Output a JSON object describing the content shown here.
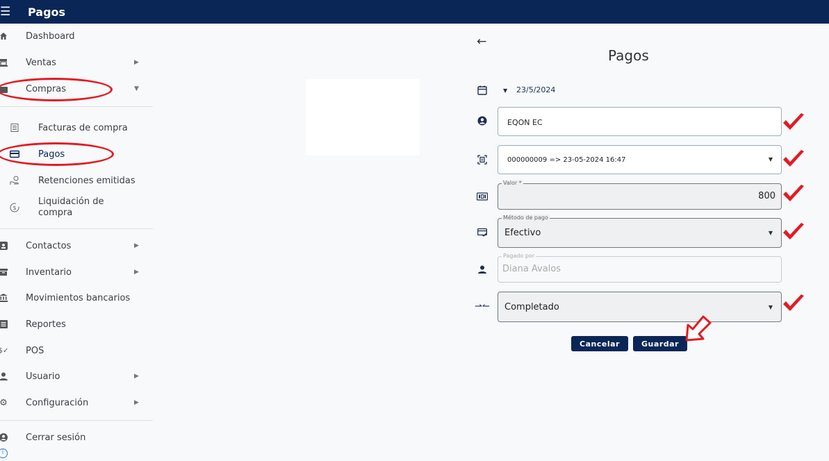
{
  "app": {
    "title": "Pagos",
    "menu_icon": "hamburger-icon"
  },
  "sidebar": {
    "items": [
      {
        "label": "Dashboard",
        "icon": "home-icon"
      },
      {
        "label": "Ventas",
        "icon": "register-icon",
        "expandable": true
      },
      {
        "label": "Compras",
        "icon": "bag-icon",
        "expanded": true
      },
      {
        "label": "Facturas de compra",
        "icon": "document-icon"
      },
      {
        "label": "Pagos",
        "icon": "card-icon",
        "active": true
      },
      {
        "label": "Retenciones emitidas",
        "icon": "hand-coin-icon"
      },
      {
        "label": "Liquidación de compra",
        "icon": "dollar-cycle-icon"
      },
      {
        "label": "Contactos",
        "icon": "contact-icon",
        "expandable": true
      },
      {
        "label": "Inventario",
        "icon": "archive-icon",
        "expandable": true
      },
      {
        "label": "Movimientos bancarios",
        "icon": "bank-icon"
      },
      {
        "label": "Reportes",
        "icon": "report-icon"
      },
      {
        "label": "POS",
        "icon": "pos-icon"
      },
      {
        "label": "Usuario",
        "icon": "user-icon",
        "expandable": true
      },
      {
        "label": "Configuración",
        "icon": "gear-icon",
        "expandable": true
      },
      {
        "label": "Cerrar sesión",
        "icon": "account-circle-icon"
      }
    ]
  },
  "form": {
    "title": "Pagos",
    "date": "23/5/2024",
    "contact": "EQON EC",
    "invoice": "000000009 => 23-05-2024 16:47",
    "valor_label": "Valor *",
    "valor": "800",
    "metodo_label": "Método de pago",
    "metodo": "Efectivo",
    "pagado_label": "Pagado por",
    "pagado_placeholder": "Diana Avalos",
    "estado": "Completado",
    "cancel_label": "Cancelar",
    "save_label": "Guardar"
  },
  "colors": {
    "primary": "#0a2657",
    "annotation": "#e31b23",
    "background": "#f7f9fb"
  }
}
